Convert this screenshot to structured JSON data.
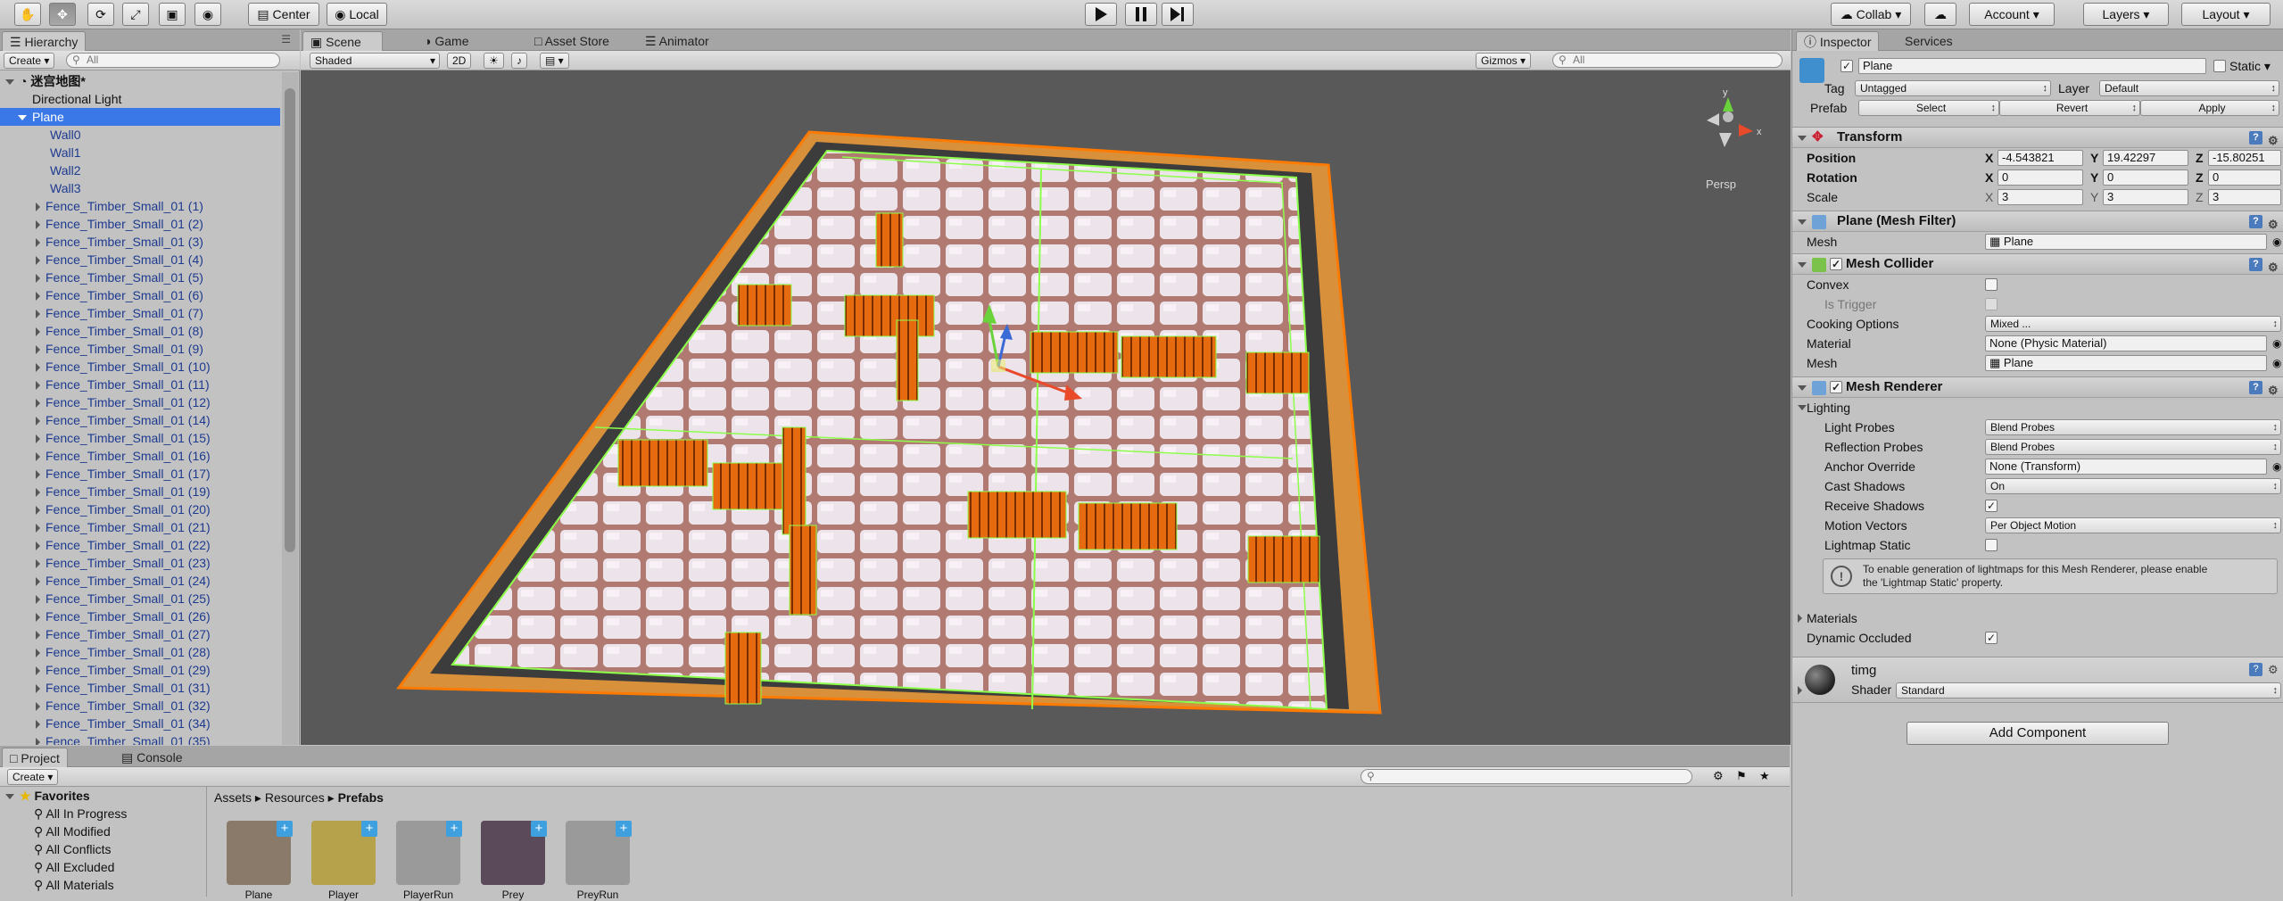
{
  "toolbar": {
    "tools": [
      "hand-tool",
      "move-tool",
      "rotate-tool",
      "scale-tool",
      "rect-tool",
      "transform-tool"
    ],
    "pivot_center": "Center",
    "pivot_local": "Local",
    "collab": "Collab",
    "account": "Account",
    "layers": "Layers",
    "layout": "Layout"
  },
  "hierarchy": {
    "tab": "Hierarchy",
    "create": "Create",
    "search_placeholder": "All",
    "scene": "迷宫地图*",
    "items": [
      "Directional Light",
      "Plane",
      "Wall0",
      "Wall1",
      "Wall2",
      "Wall3",
      "Fence_Timber_Small_01 (1)",
      "Fence_Timber_Small_01 (2)",
      "Fence_Timber_Small_01 (3)",
      "Fence_Timber_Small_01 (4)",
      "Fence_Timber_Small_01 (5)",
      "Fence_Timber_Small_01 (6)",
      "Fence_Timber_Small_01 (7)",
      "Fence_Timber_Small_01 (8)",
      "Fence_Timber_Small_01 (9)",
      "Fence_Timber_Small_01 (10)",
      "Fence_Timber_Small_01 (11)",
      "Fence_Timber_Small_01 (12)",
      "Fence_Timber_Small_01 (14)",
      "Fence_Timber_Small_01 (15)",
      "Fence_Timber_Small_01 (16)",
      "Fence_Timber_Small_01 (17)",
      "Fence_Timber_Small_01 (19)",
      "Fence_Timber_Small_01 (20)",
      "Fence_Timber_Small_01 (21)",
      "Fence_Timber_Small_01 (22)",
      "Fence_Timber_Small_01 (23)",
      "Fence_Timber_Small_01 (24)",
      "Fence_Timber_Small_01 (25)",
      "Fence_Timber_Small_01 (26)",
      "Fence_Timber_Small_01 (27)",
      "Fence_Timber_Small_01 (28)",
      "Fence_Timber_Small_01 (29)",
      "Fence_Timber_Small_01 (31)",
      "Fence_Timber_Small_01 (32)",
      "Fence_Timber_Small_01 (34)",
      "Fence_Timber_Small_01 (35)"
    ]
  },
  "scene": {
    "tabs": [
      "Scene",
      "Game",
      "Asset Store",
      "Animator"
    ],
    "shading": "Shaded",
    "mode_2d": "2D",
    "gizmos": "Gizmos",
    "search_placeholder": "All",
    "persp": "Persp"
  },
  "inspector": {
    "tabs": [
      "Inspector",
      "Services"
    ],
    "object_name": "Plane",
    "static_label": "Static",
    "tag_label": "Tag",
    "tag_value": "Untagged",
    "layer_label": "Layer",
    "layer_value": "Default",
    "prefab_label": "Prefab",
    "prefab_select": "Select",
    "prefab_revert": "Revert",
    "prefab_apply": "Apply",
    "transform": {
      "title": "Transform",
      "position_label": "Position",
      "position": {
        "x": "-4.543821",
        "y": "19.42297",
        "z": "-15.80251"
      },
      "rotation_label": "Rotation",
      "rotation": {
        "x": "0",
        "y": "0",
        "z": "0"
      },
      "scale_label": "Scale",
      "scale": {
        "x": "3",
        "y": "3",
        "z": "3"
      },
      "axis_x": "X",
      "axis_y": "Y",
      "axis_z": "Z"
    },
    "mesh_filter": {
      "title": "Plane (Mesh Filter)",
      "mesh_label": "Mesh",
      "mesh_value": "Plane"
    },
    "mesh_collider": {
      "title": "Mesh Collider",
      "convex": "Convex",
      "is_trigger": "Is Trigger",
      "cooking_label": "Cooking Options",
      "cooking_value": "Mixed ...",
      "material_label": "Material",
      "material_value": "None (Physic Material)",
      "mesh_label": "Mesh",
      "mesh_value": "Plane"
    },
    "mesh_renderer": {
      "title": "Mesh Renderer",
      "lighting": "Lighting",
      "light_probes_label": "Light Probes",
      "light_probes": "Blend Probes",
      "reflection_probes_label": "Reflection Probes",
      "reflection_probes": "Blend Probes",
      "anchor_label": "Anchor Override",
      "anchor_value": "None (Transform)",
      "cast_shadows_label": "Cast Shadows",
      "cast_shadows": "On",
      "receive_shadows_label": "Receive Shadows",
      "motion_vectors_label": "Motion Vectors",
      "motion_vectors": "Per Object Motion",
      "lightmap_static_label": "Lightmap Static",
      "info_line1": "To enable generation of lightmaps for this Mesh Renderer, please enable",
      "info_line2": "the 'Lightmap Static' property.",
      "materials": "Materials",
      "dynamic_occluded": "Dynamic Occluded"
    },
    "material": {
      "name": "timg",
      "shader_label": "Shader",
      "shader_value": "Standard"
    },
    "add_component": "Add Component"
  },
  "project": {
    "tabs": [
      "Project",
      "Console"
    ],
    "create": "Create",
    "favorites": "Favorites",
    "fav_items": [
      "All In Progress",
      "All Modified",
      "All Conflicts",
      "All Excluded",
      "All Materials"
    ],
    "breadcrumb": [
      "Assets",
      "Resources",
      "Prefabs"
    ],
    "assets": [
      "Plane",
      "Player",
      "PlayerRun",
      "Prey",
      "PreyRun"
    ]
  },
  "colors": {
    "selection": "#3b78e7",
    "accent_orange": "#ff7a00",
    "fence_green": "#8cff4a",
    "scene_bg": "#595959"
  }
}
